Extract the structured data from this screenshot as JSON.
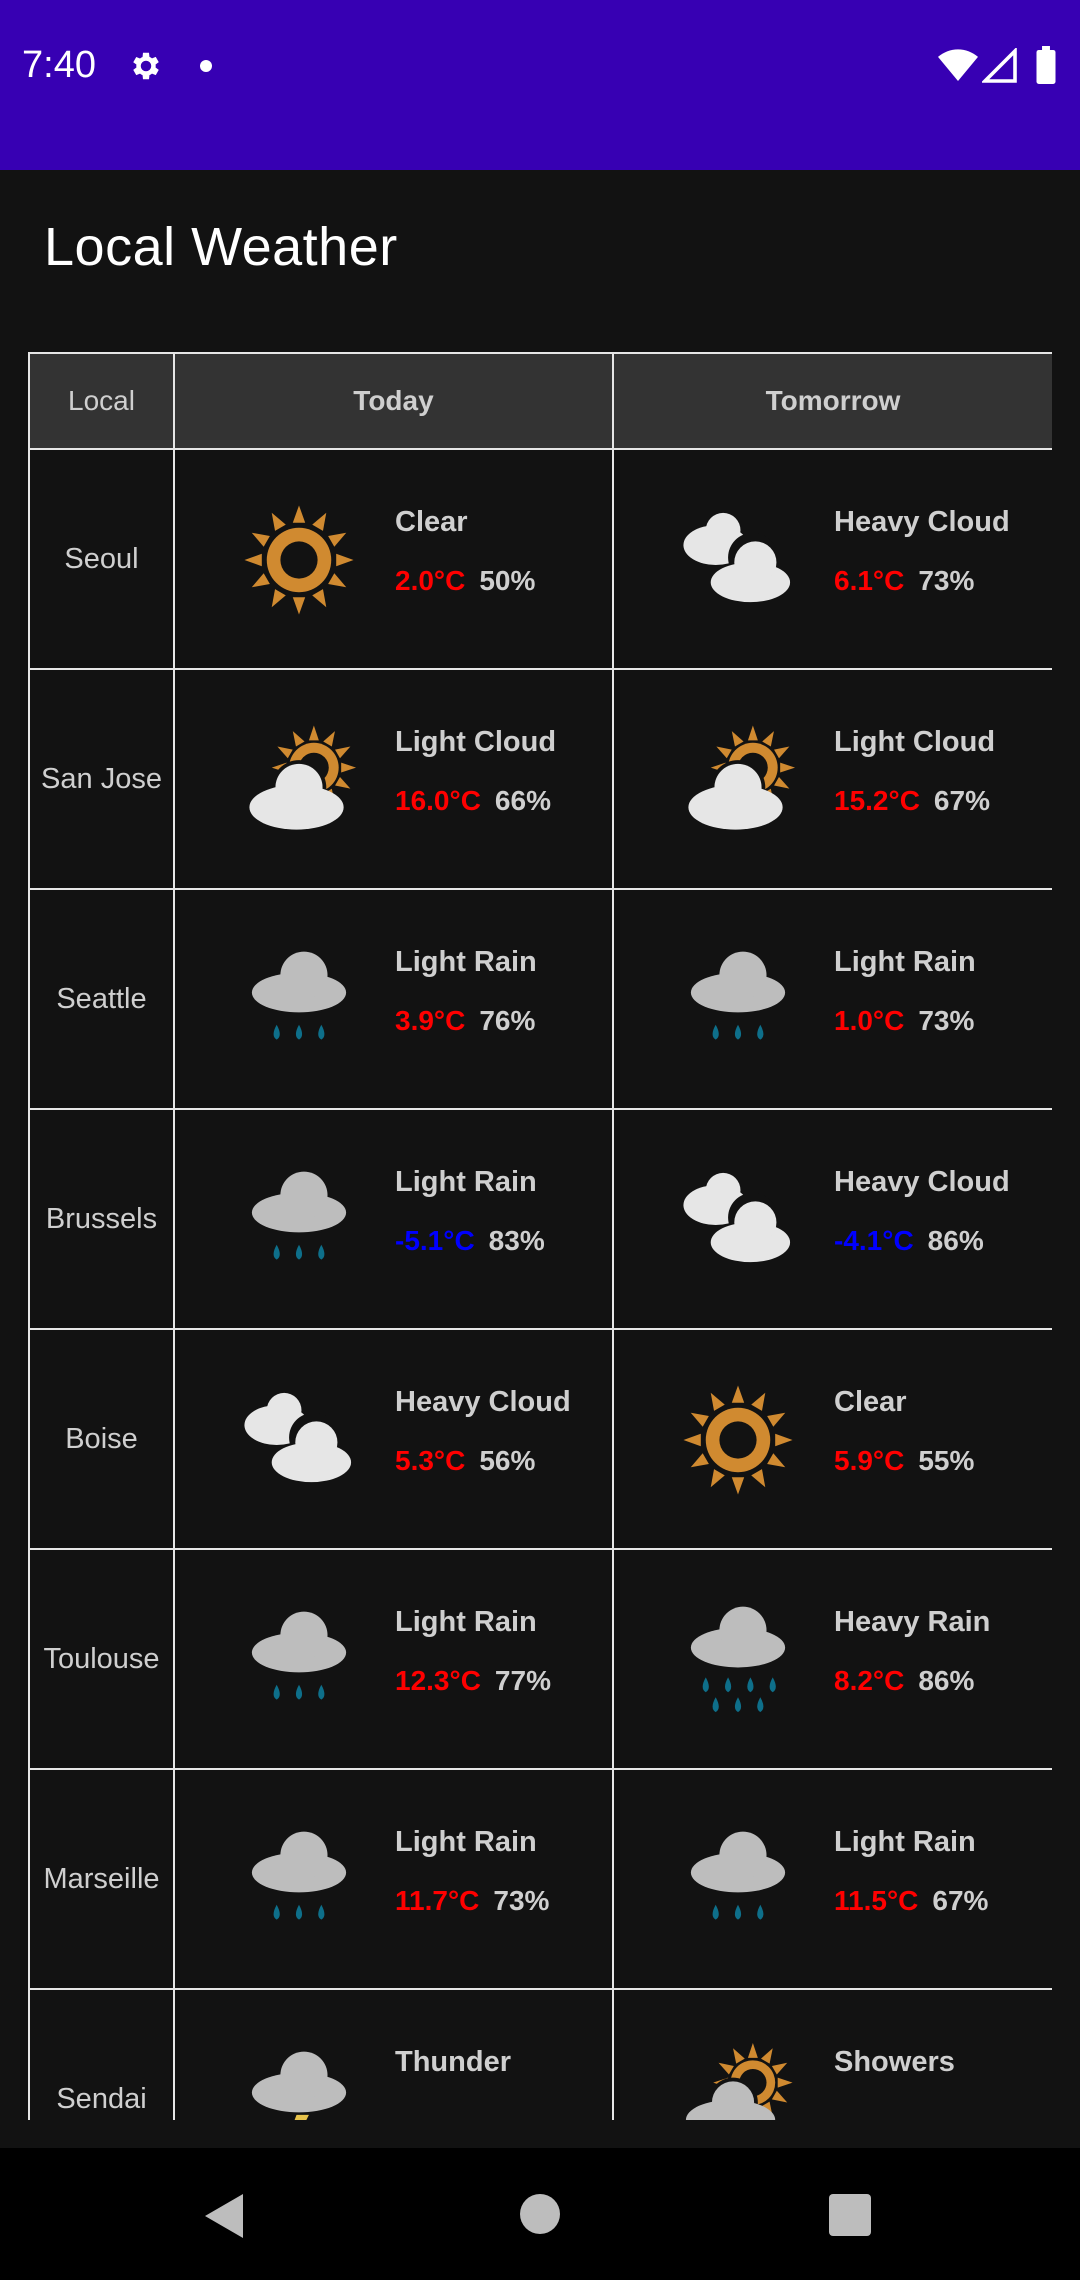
{
  "status_bar": {
    "time": "7:40",
    "icons": [
      "gear-icon",
      "notification-dot-icon",
      "wifi-icon",
      "cell-signal-icon",
      "battery-icon"
    ]
  },
  "app": {
    "title": "Local Weather"
  },
  "colors": {
    "status_bar_bg": "#3700b3",
    "background": "#121212",
    "header_bg": "#333333",
    "temp_warm": "#ff0000",
    "temp_cold": "#0000ff",
    "sun": "#d08a30",
    "rain_drop": "#0e6f8a"
  },
  "table": {
    "headers": {
      "local": "Local",
      "today": "Today",
      "tomorrow": "Tomorrow"
    },
    "rows": [
      {
        "city": "Seoul",
        "today": {
          "icon": "sun-icon",
          "condition": "Clear",
          "temp": "2.0°C",
          "humidity": "50%"
        },
        "tomorrow": {
          "icon": "heavy-cloud-icon",
          "condition": "Heavy Cloud",
          "temp": "6.1°C",
          "humidity": "73%"
        }
      },
      {
        "city": "San Jose",
        "today": {
          "icon": "light-cloud-icon",
          "condition": "Light Cloud",
          "temp": "16.0°C",
          "humidity": "66%"
        },
        "tomorrow": {
          "icon": "light-cloud-icon",
          "condition": "Light Cloud",
          "temp": "15.2°C",
          "humidity": "67%"
        }
      },
      {
        "city": "Seattle",
        "today": {
          "icon": "light-rain-icon",
          "condition": "Light Rain",
          "temp": "3.9°C",
          "humidity": "76%"
        },
        "tomorrow": {
          "icon": "light-rain-icon",
          "condition": "Light Rain",
          "temp": "1.0°C",
          "humidity": "73%"
        }
      },
      {
        "city": "Brussels",
        "today": {
          "icon": "light-rain-icon",
          "condition": "Light Rain",
          "temp": "-5.1°C",
          "humidity": "83%"
        },
        "tomorrow": {
          "icon": "heavy-cloud-icon",
          "condition": "Heavy Cloud",
          "temp": "-4.1°C",
          "humidity": "86%"
        }
      },
      {
        "city": "Boise",
        "today": {
          "icon": "heavy-cloud-icon",
          "condition": "Heavy Cloud",
          "temp": "5.3°C",
          "humidity": "56%"
        },
        "tomorrow": {
          "icon": "sun-icon",
          "condition": "Clear",
          "temp": "5.9°C",
          "humidity": "55%"
        }
      },
      {
        "city": "Toulouse",
        "today": {
          "icon": "light-rain-icon",
          "condition": "Light Rain",
          "temp": "12.3°C",
          "humidity": "77%"
        },
        "tomorrow": {
          "icon": "heavy-rain-icon",
          "condition": "Heavy Rain",
          "temp": "8.2°C",
          "humidity": "86%"
        }
      },
      {
        "city": "Marseille",
        "today": {
          "icon": "light-rain-icon",
          "condition": "Light Rain",
          "temp": "11.7°C",
          "humidity": "73%"
        },
        "tomorrow": {
          "icon": "light-rain-icon",
          "condition": "Light Rain",
          "temp": "11.5°C",
          "humidity": "67%"
        }
      },
      {
        "city": "Sendai",
        "today": {
          "icon": "thunder-icon",
          "condition": "Thunder",
          "temp": "",
          "humidity": ""
        },
        "tomorrow": {
          "icon": "showers-icon",
          "condition": "Showers",
          "temp": "",
          "humidity": ""
        }
      }
    ]
  },
  "nav_bar": {
    "icons": [
      "back-icon",
      "home-icon",
      "recents-icon"
    ]
  }
}
